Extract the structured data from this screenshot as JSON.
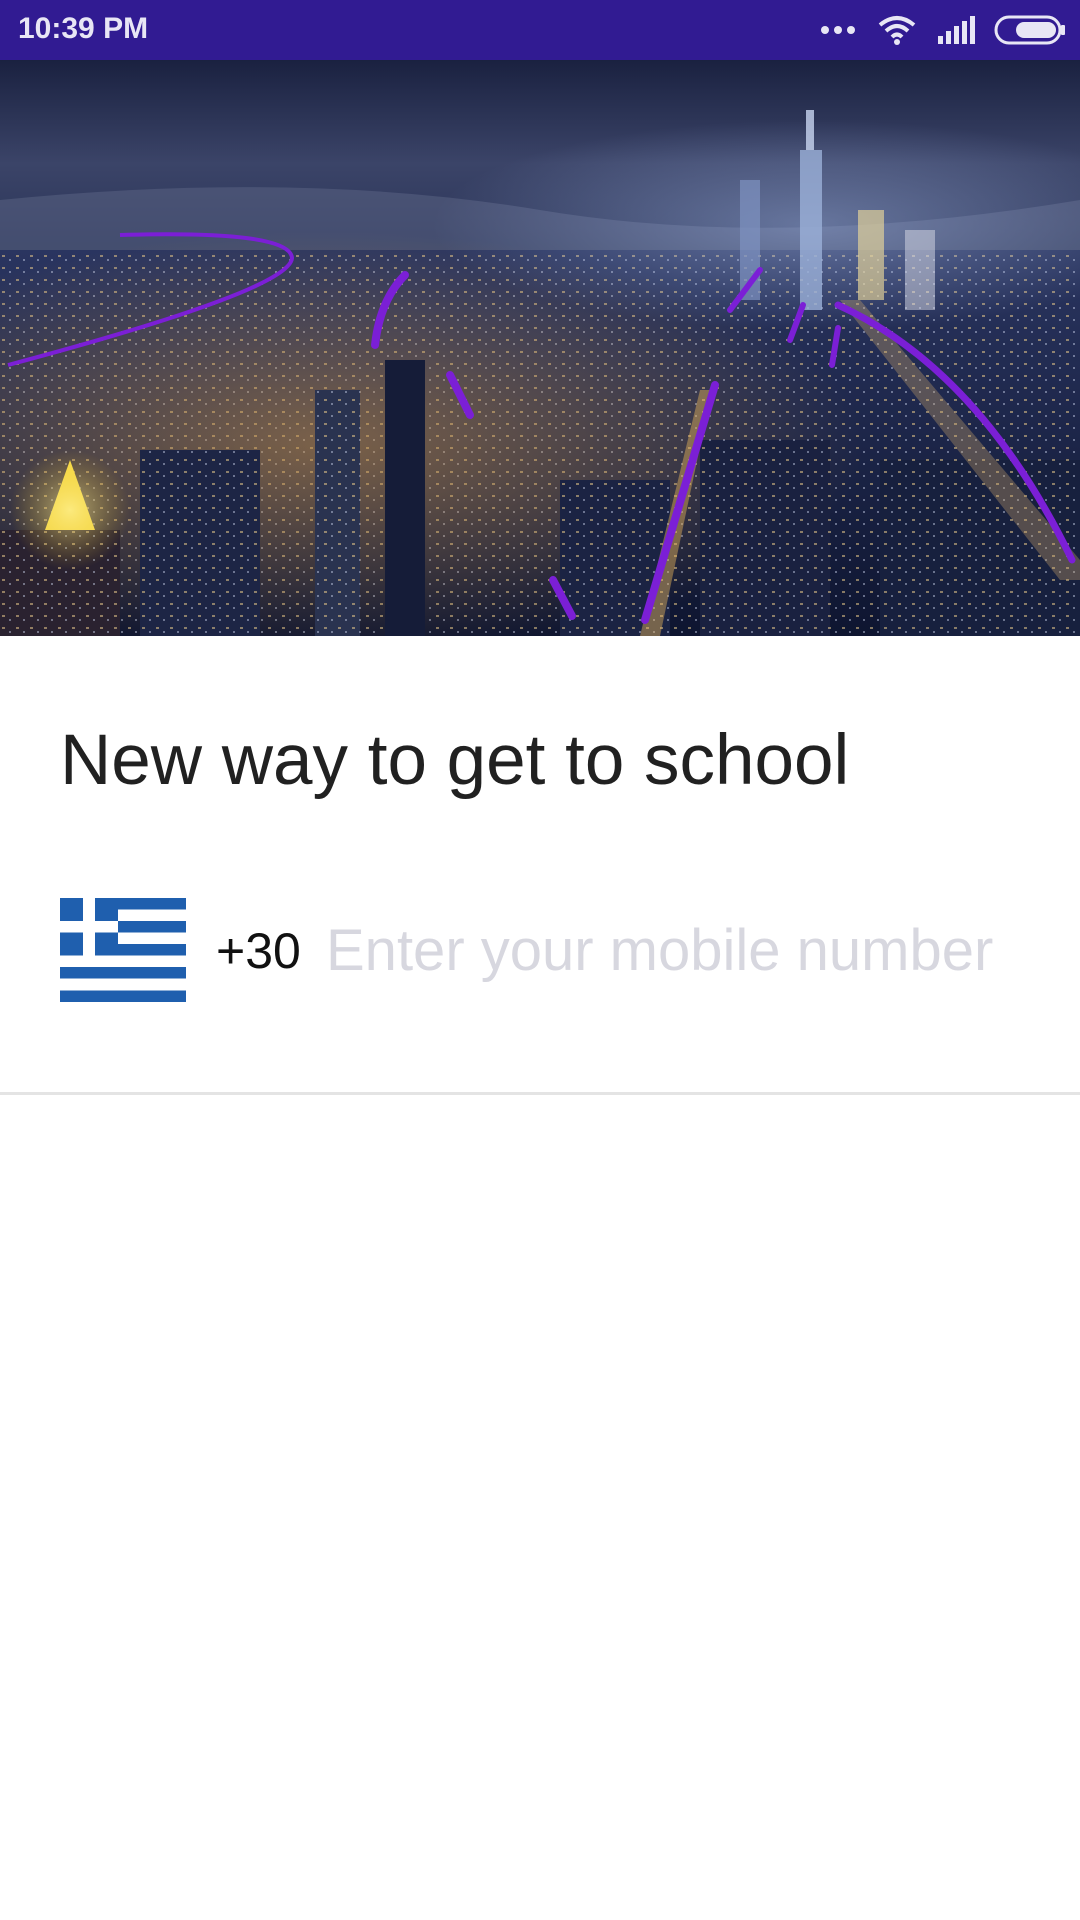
{
  "status_bar": {
    "time": "10:39 PM",
    "background": "#311b92",
    "icons": [
      "more-dots-icon",
      "wifi-icon",
      "signal-icon",
      "battery-icon"
    ]
  },
  "hero": {
    "image": "night-city-skyline"
  },
  "main": {
    "title": "New way to get to school"
  },
  "phone": {
    "country_flag": "greece-flag-icon",
    "dial_code": "+30",
    "value": "",
    "placeholder": "Enter your mobile number"
  },
  "colors": {
    "accent": "#311b92",
    "route_lines": "#7b1fd6",
    "placeholder": "#d7d7df",
    "flag_blue": "#1f5fae"
  }
}
